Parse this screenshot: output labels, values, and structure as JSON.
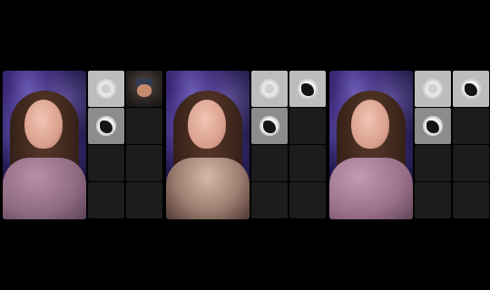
{
  "panels": [
    {
      "id": "panel-1",
      "main_camera": "host-video",
      "tiles": [
        "avatar-light",
        "guest-video",
        "avatar-dark",
        "empty",
        "empty",
        "empty",
        "empty",
        "empty"
      ]
    },
    {
      "id": "panel-2",
      "main_camera": "host-video",
      "tiles": [
        "avatar-light",
        "avatar-dark",
        "avatar-dark",
        "empty",
        "empty",
        "empty",
        "empty",
        "empty"
      ]
    },
    {
      "id": "panel-3",
      "main_camera": "host-video",
      "tiles": [
        "avatar-light",
        "avatar-dark",
        "avatar-dark",
        "empty",
        "empty",
        "empty",
        "empty",
        "empty"
      ]
    }
  ],
  "colors": {
    "background": "#000000",
    "tile_empty": "#1c1c1c",
    "tile_light": "#bdbdbd",
    "tile_mid": "#8c8c8c",
    "nebula_purple": "#6b5bb5"
  }
}
